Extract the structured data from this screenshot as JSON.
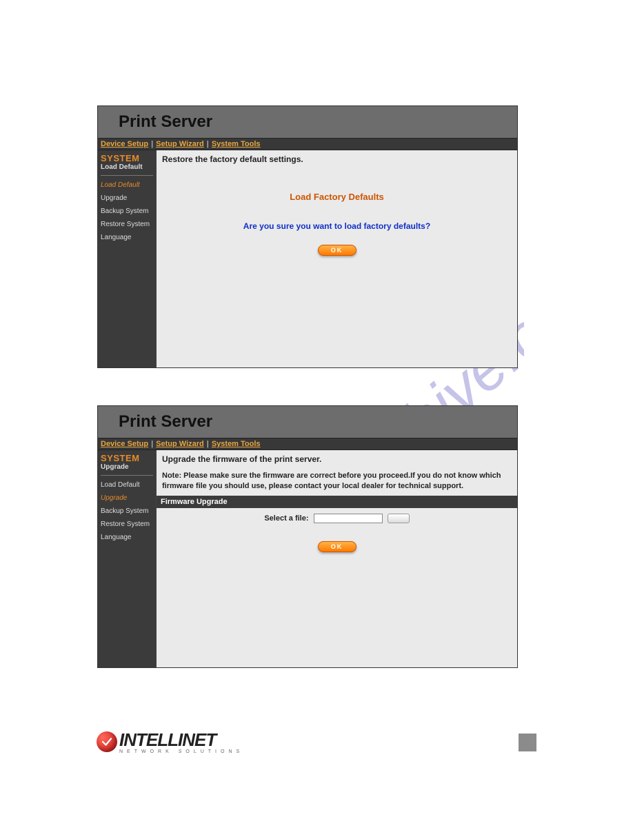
{
  "watermark": "manualshive.com",
  "panels": {
    "p1": {
      "title": "Print Server",
      "nav": {
        "item1": "Device Setup",
        "item2": "Setup Wizard",
        "item3": "System Tools"
      },
      "sidebar": {
        "heading": "SYSTEM",
        "sub": "Load Default",
        "items": {
          "i0": "Load Default",
          "i1": "Upgrade",
          "i2": "Backup System",
          "i3": "Restore System",
          "i4": "Language"
        }
      },
      "content": {
        "header": "Restore the factory default settings.",
        "section_title": "Load Factory Defaults",
        "confirm": "Are you sure you want to load factory defaults?",
        "ok": "OK"
      }
    },
    "p2": {
      "title": "Print Server",
      "nav": {
        "item1": "Device Setup",
        "item2": "Setup Wizard",
        "item3": "System Tools"
      },
      "sidebar": {
        "heading": "SYSTEM",
        "sub": "Upgrade",
        "items": {
          "i0": "Load Default",
          "i1": "Upgrade",
          "i2": "Backup System",
          "i3": "Restore System",
          "i4": "Language"
        }
      },
      "content": {
        "header": "Upgrade the firmware of the print server.",
        "note": "Note: Please make sure the firmware are correct before you proceed.If you do not know which firmware file you should use, please contact your local dealer for technical support.",
        "strip": "Firmware Upgrade",
        "file_label": "Select a file:",
        "ok": "OK"
      }
    }
  },
  "footer": {
    "brand": "INTELLINET",
    "tag": "NETWORK SOLUTIONS"
  }
}
